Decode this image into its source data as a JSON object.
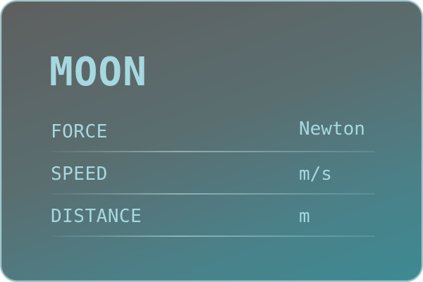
{
  "card": {
    "title": "MOON",
    "rows": [
      {
        "label": "FORCE",
        "unit": "Newton"
      },
      {
        "label": "SPEED",
        "unit": "m/s"
      },
      {
        "label": "DISTANCE",
        "unit": "m"
      }
    ]
  },
  "colors": {
    "text": "#a6d8e0",
    "border": "#9fc7cc",
    "gradient_start": "#5e5f5f",
    "gradient_end": "#3d8a93"
  }
}
